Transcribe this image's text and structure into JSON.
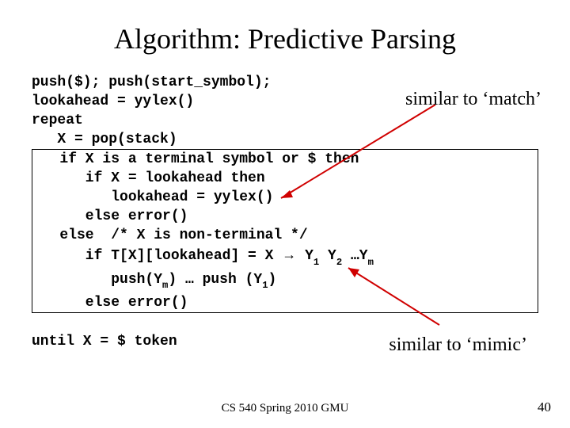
{
  "title": "Algorithm: Predictive Parsing",
  "code": {
    "l1": "push($); push(start_symbol);",
    "l2": "lookahead = yylex()",
    "l3": "repeat",
    "l4": "   X = pop(stack)",
    "l5": "   if X is a terminal symbol or $ then",
    "l6": "      if X = lookahead then",
    "l7": "         lookahead = yylex()",
    "l8": "      else error()",
    "l9": "   else  /* X is non-terminal */",
    "l10a": "      if T[X][lookahead] = X ",
    "l10arrow": "→",
    "l10b_y1": " Y",
    "l10b_y2": " Y",
    "l10b_dots": " …Y",
    "l11a": "         push(Y",
    "l11b": ") … push (Y",
    "l11c": ")",
    "l12": "      else error()",
    "l13": "until X = $ token"
  },
  "sub": {
    "one": "1",
    "two": "2",
    "m": "m"
  },
  "annotations": {
    "match": "similar to ‘match’",
    "mimic": "similar to ‘mimic’"
  },
  "footer": "CS 540 Spring 2010 GMU",
  "page": "40"
}
